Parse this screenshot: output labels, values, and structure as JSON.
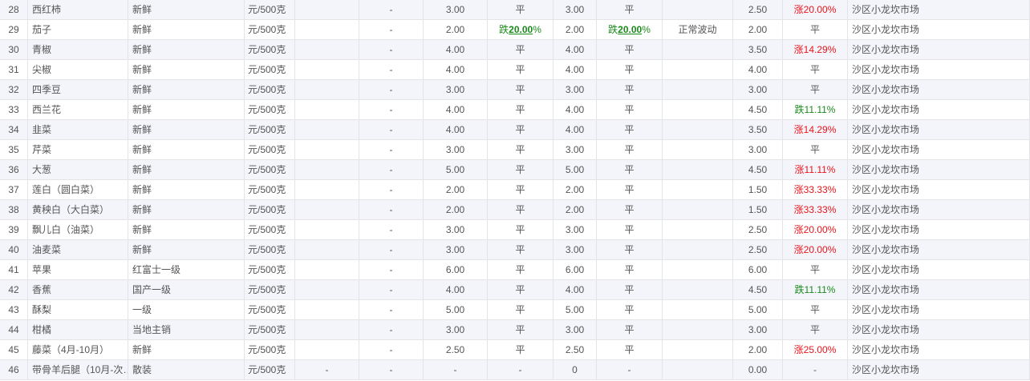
{
  "colors": {
    "change": {
      "涨": "#e8151b",
      "跌": "#1a8a1a"
    }
  },
  "rows": [
    [
      "28",
      "西红柿",
      "新鲜",
      "元/500克",
      "",
      "-",
      "3.00",
      "平",
      "3.00",
      "平",
      "",
      "2.50",
      {
        "dir": "涨",
        "num": "20.00",
        "pct": "%"
      },
      "沙区小龙坎市场"
    ],
    [
      "29",
      "茄子",
      "新鲜",
      "元/500克",
      "",
      "-",
      "2.00",
      {
        "dir": "跌",
        "num": "20.00",
        "pct": "%",
        "emph": true
      },
      "2.00",
      {
        "dir": "跌",
        "num": "20.00",
        "pct": "%",
        "emph": true
      },
      "正常波动",
      "2.00",
      "平",
      "沙区小龙坎市场"
    ],
    [
      "30",
      "青椒",
      "新鲜",
      "元/500克",
      "",
      "-",
      "4.00",
      "平",
      "4.00",
      "平",
      "",
      "3.50",
      {
        "dir": "涨",
        "num": "14.29",
        "pct": "%"
      },
      "沙区小龙坎市场"
    ],
    [
      "31",
      "尖椒",
      "新鲜",
      "元/500克",
      "",
      "-",
      "4.00",
      "平",
      "4.00",
      "平",
      "",
      "4.00",
      "平",
      "沙区小龙坎市场"
    ],
    [
      "32",
      "四季豆",
      "新鲜",
      "元/500克",
      "",
      "-",
      "3.00",
      "平",
      "3.00",
      "平",
      "",
      "3.00",
      "平",
      "沙区小龙坎市场"
    ],
    [
      "33",
      "西兰花",
      "新鲜",
      "元/500克",
      "",
      "-",
      "4.00",
      "平",
      "4.00",
      "平",
      "",
      "4.50",
      {
        "dir": "跌",
        "num": "11.11",
        "pct": "%"
      },
      "沙区小龙坎市场"
    ],
    [
      "34",
      "韭菜",
      "新鲜",
      "元/500克",
      "",
      "-",
      "4.00",
      "平",
      "4.00",
      "平",
      "",
      "3.50",
      {
        "dir": "涨",
        "num": "14.29",
        "pct": "%"
      },
      "沙区小龙坎市场"
    ],
    [
      "35",
      "芹菜",
      "新鲜",
      "元/500克",
      "",
      "-",
      "3.00",
      "平",
      "3.00",
      "平",
      "",
      "3.00",
      "平",
      "沙区小龙坎市场"
    ],
    [
      "36",
      "大葱",
      "新鲜",
      "元/500克",
      "",
      "-",
      "5.00",
      "平",
      "5.00",
      "平",
      "",
      "4.50",
      {
        "dir": "涨",
        "num": "11.11",
        "pct": "%"
      },
      "沙区小龙坎市场"
    ],
    [
      "37",
      "莲白（圆白菜）",
      "新鲜",
      "元/500克",
      "",
      "-",
      "2.00",
      "平",
      "2.00",
      "平",
      "",
      "1.50",
      {
        "dir": "涨",
        "num": "33.33",
        "pct": "%"
      },
      "沙区小龙坎市场"
    ],
    [
      "38",
      "黄秧白（大白菜）",
      "新鲜",
      "元/500克",
      "",
      "-",
      "2.00",
      "平",
      "2.00",
      "平",
      "",
      "1.50",
      {
        "dir": "涨",
        "num": "33.33",
        "pct": "%"
      },
      "沙区小龙坎市场"
    ],
    [
      "39",
      "飘儿白（油菜）",
      "新鲜",
      "元/500克",
      "",
      "-",
      "3.00",
      "平",
      "3.00",
      "平",
      "",
      "2.50",
      {
        "dir": "涨",
        "num": "20.00",
        "pct": "%"
      },
      "沙区小龙坎市场"
    ],
    [
      "40",
      "油麦菜",
      "新鲜",
      "元/500克",
      "",
      "-",
      "3.00",
      "平",
      "3.00",
      "平",
      "",
      "2.50",
      {
        "dir": "涨",
        "num": "20.00",
        "pct": "%"
      },
      "沙区小龙坎市场"
    ],
    [
      "41",
      "苹果",
      "红富士一级",
      "元/500克",
      "",
      "-",
      "6.00",
      "平",
      "6.00",
      "平",
      "",
      "6.00",
      "平",
      "沙区小龙坎市场"
    ],
    [
      "42",
      "香蕉",
      "国产一级",
      "元/500克",
      "",
      "-",
      "4.00",
      "平",
      "4.00",
      "平",
      "",
      "4.50",
      {
        "dir": "跌",
        "num": "11.11",
        "pct": "%"
      },
      "沙区小龙坎市场"
    ],
    [
      "43",
      "酥梨",
      "一级",
      "元/500克",
      "",
      "-",
      "5.00",
      "平",
      "5.00",
      "平",
      "",
      "5.00",
      "平",
      "沙区小龙坎市场"
    ],
    [
      "44",
      "柑橘",
      "当地主销",
      "元/500克",
      "",
      "-",
      "3.00",
      "平",
      "3.00",
      "平",
      "",
      "3.00",
      "平",
      "沙区小龙坎市场"
    ],
    [
      "45",
      "藤菜（4月-10月）",
      "新鲜",
      "元/500克",
      "",
      "-",
      "2.50",
      "平",
      "2.50",
      "平",
      "",
      "2.00",
      {
        "dir": "涨",
        "num": "25.00",
        "pct": "%"
      },
      "沙区小龙坎市场"
    ],
    [
      "46",
      "带骨羊后腿（10月-次…",
      "散装",
      "元/500克",
      "-",
      "-",
      "-",
      "-",
      "0",
      "-",
      "",
      "0.00",
      "-",
      "沙区小龙坎市场"
    ]
  ]
}
